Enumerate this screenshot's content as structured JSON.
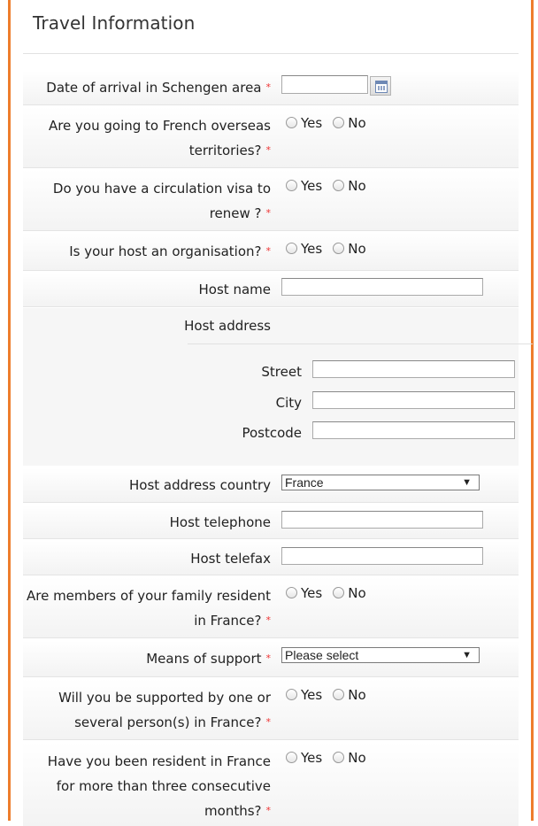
{
  "page": {
    "title": "Travel Information",
    "required_mark": "*",
    "accent_color": "#ee7d2c"
  },
  "radio": {
    "yes": "Yes",
    "no": "No"
  },
  "fields": {
    "arrival_date": {
      "label": "Date of arrival in Schengen area",
      "value": "",
      "icon": "calendar-icon"
    },
    "overseas": {
      "label_line1": "Are you going to French overseas",
      "label_line2": "territories?"
    },
    "circulation_visa": {
      "label_line1": "Do you have a circulation visa to",
      "label_line2": "renew ?"
    },
    "host_org": {
      "label": "Is your host an organisation?"
    },
    "host_name": {
      "label": "Host name",
      "value": ""
    },
    "host_address": {
      "label": "Host address",
      "street_label": "Street",
      "street_value": "",
      "city_label": "City",
      "city_value": "",
      "postcode_label": "Postcode",
      "postcode_value": ""
    },
    "host_country": {
      "label": "Host address country",
      "selected": "France"
    },
    "host_telephone": {
      "label": "Host telephone",
      "value": ""
    },
    "host_telefax": {
      "label": "Host telefax",
      "value": ""
    },
    "family_resident": {
      "label_line1": "Are members of your family resident",
      "label_line2": "in France?"
    },
    "means_support": {
      "label": "Means of support",
      "selected": "Please select"
    },
    "supported_by": {
      "label_line1": "Will you be supported by one or",
      "label_line2": "several person(s) in France?"
    },
    "resident_france": {
      "label_line1": "Have you been resident in France",
      "label_line2": "for more than three consecutive",
      "label_line3": "months?"
    }
  }
}
